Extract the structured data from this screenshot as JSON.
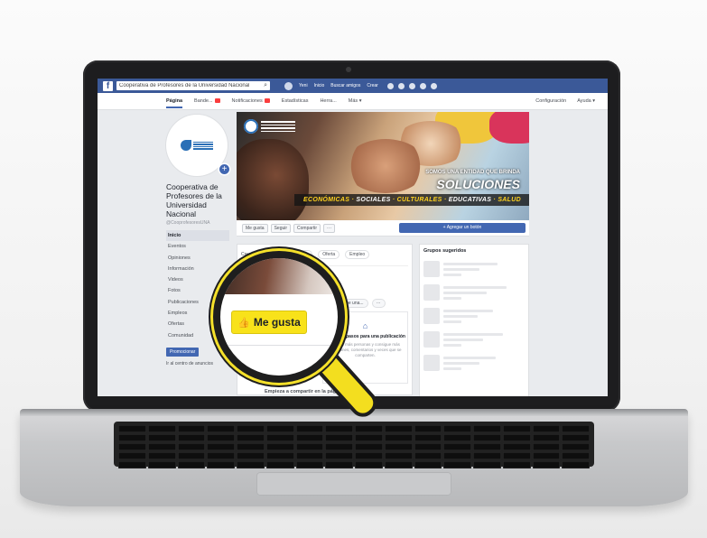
{
  "topbar": {
    "logo": "f",
    "search_value": "Cooperativa de Profesores de la Universidad Nacional",
    "nav": [
      "Yeni",
      "Inicio",
      "Buscar amigos",
      "Crear"
    ]
  },
  "page_tabs": {
    "tabs": [
      {
        "label": "Página",
        "active": true
      },
      {
        "label": "Bandeja de entrada",
        "short": "Bande...",
        "badge": true
      },
      {
        "label": "Notificaciones",
        "badge": true
      },
      {
        "label": "Estadísticas"
      },
      {
        "label": "Herramientas de publicación",
        "short": "Herra..."
      },
      {
        "label": "Más ▾"
      }
    ],
    "right": [
      "Configuración",
      "Ayuda ▾"
    ]
  },
  "page": {
    "name": "Cooperativa de Profesores de la Universidad Nacional",
    "handle": "@CooprofesoresUNA",
    "nav": [
      "Inicio",
      "Eventos",
      "Opiniones",
      "Información",
      "Videos",
      "Fotos",
      "Publicaciones",
      "Empleos",
      "Ofertas",
      "Comunidad"
    ],
    "promote_label": "Promocionar",
    "ads_label": "Ir al centro de anuncios"
  },
  "cover": {
    "tagline": "SOMOS UNA ENTIDAD QUE BRINDA",
    "headline": "SOLUCIONES",
    "strip": [
      "ECONÓMICAS",
      "SOCIALES",
      "CULTURALES",
      "EDUCATIVAS",
      "SALUD"
    ]
  },
  "actions": {
    "buttons": [
      "Me gusta",
      "Seguir",
      "Compartir",
      "···"
    ],
    "add_button": "+ Agregar un botón"
  },
  "composer": {
    "tabs": [
      "Crear",
      "Escribir",
      "Eventos",
      "Oferta",
      "Empleo"
    ],
    "chips": [
      "Escribe una...",
      "···"
    ],
    "first_post_title": "Primeros pasos para una publicación",
    "first_post_desc": "Llega a más personas y consigue más reacciones, comentarios y veces que se comparten.",
    "footer": "Empieza a compartir en la página"
  },
  "right_column": {
    "heading": "Grupos sugeridos"
  },
  "magnifier": {
    "like_label": "Me gusta",
    "like_icon": "thumbs-up-icon",
    "accent": "#f8e21a"
  }
}
